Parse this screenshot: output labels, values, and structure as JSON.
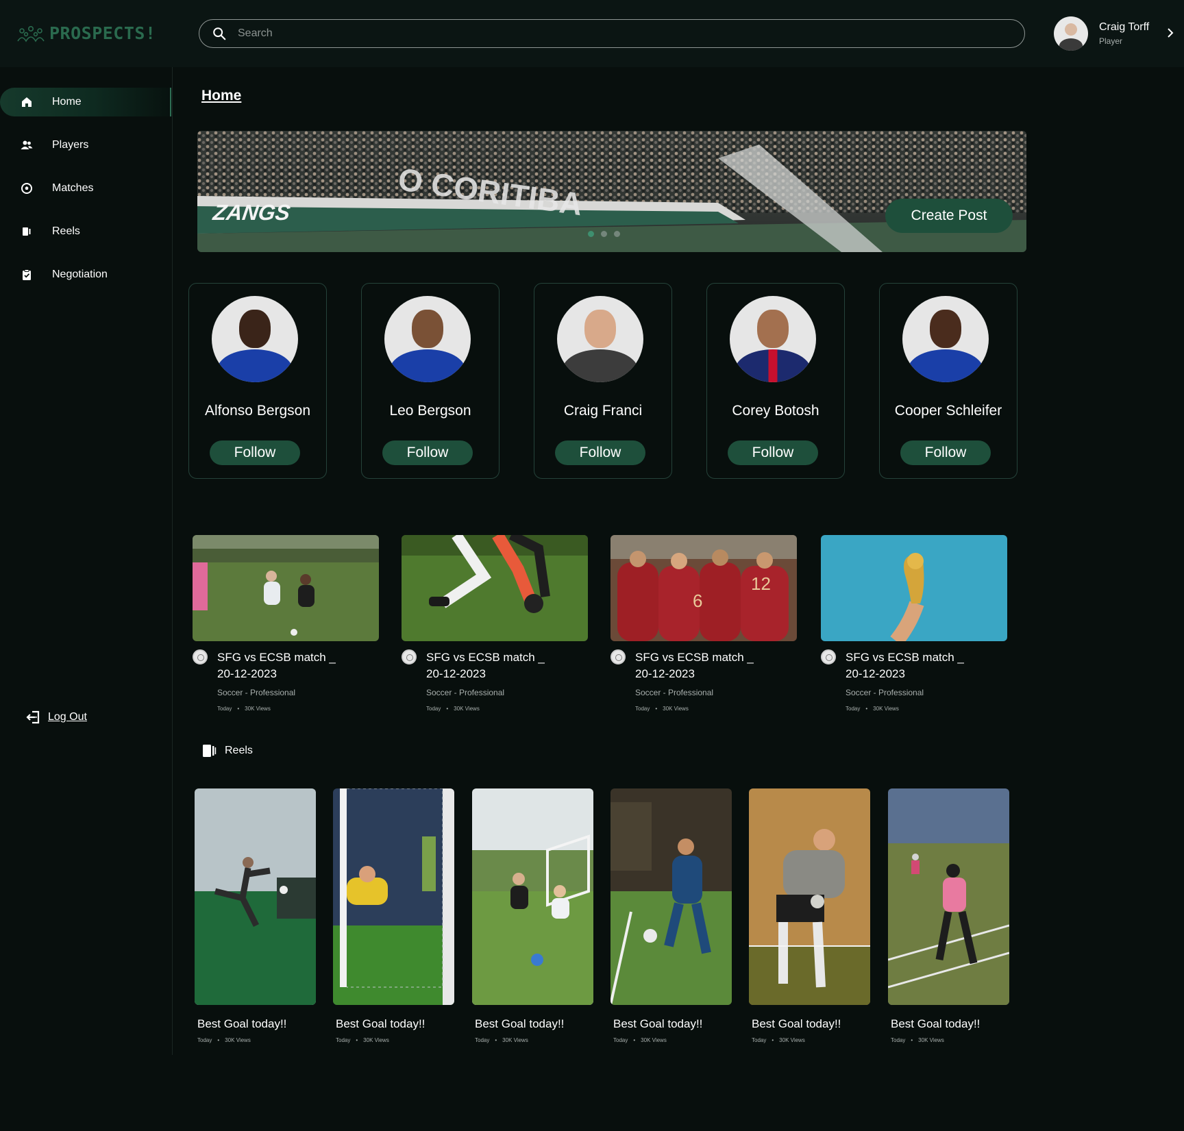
{
  "app": {
    "logo_text": "PROSPECTS!"
  },
  "search": {
    "placeholder": "Search"
  },
  "user": {
    "name": "Craig Torff",
    "role": "Player"
  },
  "sidebar": {
    "items": [
      {
        "label": "Home",
        "icon": "home-icon"
      },
      {
        "label": "Players",
        "icon": "users-icon"
      },
      {
        "label": "Matches",
        "icon": "soccer-ball-icon"
      },
      {
        "label": "Reels",
        "icon": "reels-icon"
      },
      {
        "label": "Negotiation",
        "icon": "clipboard-icon"
      }
    ],
    "logout_label": "Log Out"
  },
  "page": {
    "title": "Home"
  },
  "banner": {
    "create_post_label": "Create Post",
    "slides": 3,
    "active_slide": 1
  },
  "players": [
    {
      "name": "Alfonso Bergson",
      "follow_label": "Follow"
    },
    {
      "name": "Leo Bergson",
      "follow_label": "Follow"
    },
    {
      "name": "Craig Franci",
      "follow_label": "Follow"
    },
    {
      "name": "Corey Botosh",
      "follow_label": "Follow"
    },
    {
      "name": "Cooper Schleifer",
      "follow_label": "Follow"
    }
  ],
  "matches": [
    {
      "title": "SFG vs ECSB match _ 20-12-2023",
      "category": "Soccer - Professional",
      "date": "Today",
      "views": "30K Views"
    },
    {
      "title": "SFG vs ECSB match _ 20-12-2023",
      "category": "Soccer - Professional",
      "date": "Today",
      "views": "30K Views"
    },
    {
      "title": "SFG vs ECSB match _ 20-12-2023",
      "category": "Soccer - Professional",
      "date": "Today",
      "views": "30K Views"
    },
    {
      "title": "SFG vs ECSB match _ 20-12-2023",
      "category": "Soccer - Professional",
      "date": "Today",
      "views": "30K Views"
    }
  ],
  "reels": {
    "heading": "Reels",
    "items": [
      {
        "title": "Best Goal today!!",
        "date": "Today",
        "views": "30K Views"
      },
      {
        "title": "Best Goal today!!",
        "date": "Today",
        "views": "30K Views"
      },
      {
        "title": "Best Goal today!!",
        "date": "Today",
        "views": "30K Views"
      },
      {
        "title": "Best Goal today!!",
        "date": "Today",
        "views": "30K Views"
      },
      {
        "title": "Best Goal today!!",
        "date": "Today",
        "views": "30K Views"
      },
      {
        "title": "Best Goal today!!",
        "date": "Today",
        "views": "30K Views"
      }
    ]
  },
  "colors": {
    "background": "#080f0d",
    "accent": "#1e4f3b",
    "logo": "#2a6a4e"
  }
}
